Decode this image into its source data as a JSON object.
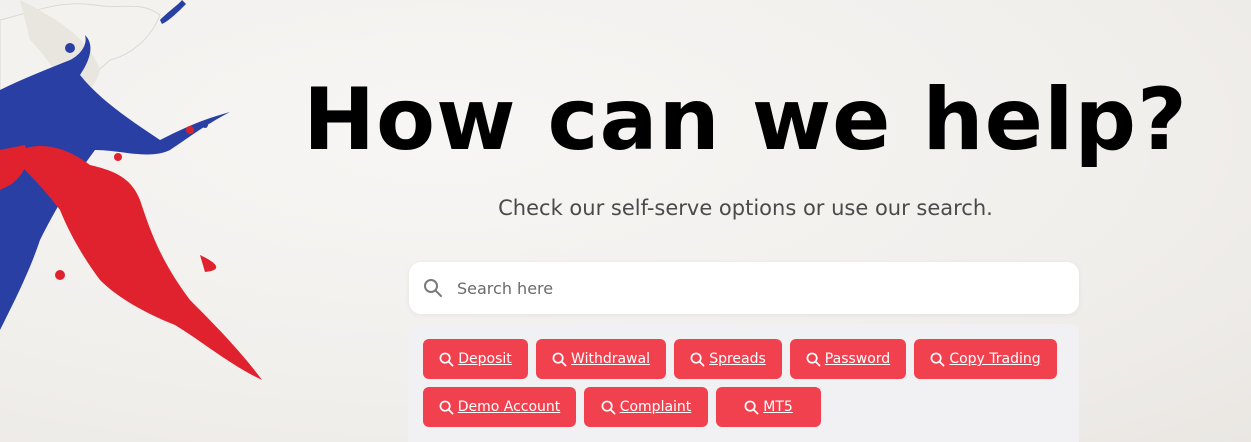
{
  "hero": {
    "title": "How can we help?",
    "subtitle": "Check our self-serve options or use our search."
  },
  "search": {
    "placeholder": "Search here",
    "icon": "search-icon"
  },
  "quick_links": [
    {
      "label": "Deposit"
    },
    {
      "label": "Withdrawal"
    },
    {
      "label": "Spreads"
    },
    {
      "label": "Password"
    },
    {
      "label": "Copy Trading"
    },
    {
      "label": "Demo Account"
    },
    {
      "label": "Complaint"
    },
    {
      "label": "MT5"
    }
  ],
  "colors": {
    "accent": "#f1404e",
    "splash_blue": "#2a3fa3",
    "splash_red": "#e0222f"
  }
}
